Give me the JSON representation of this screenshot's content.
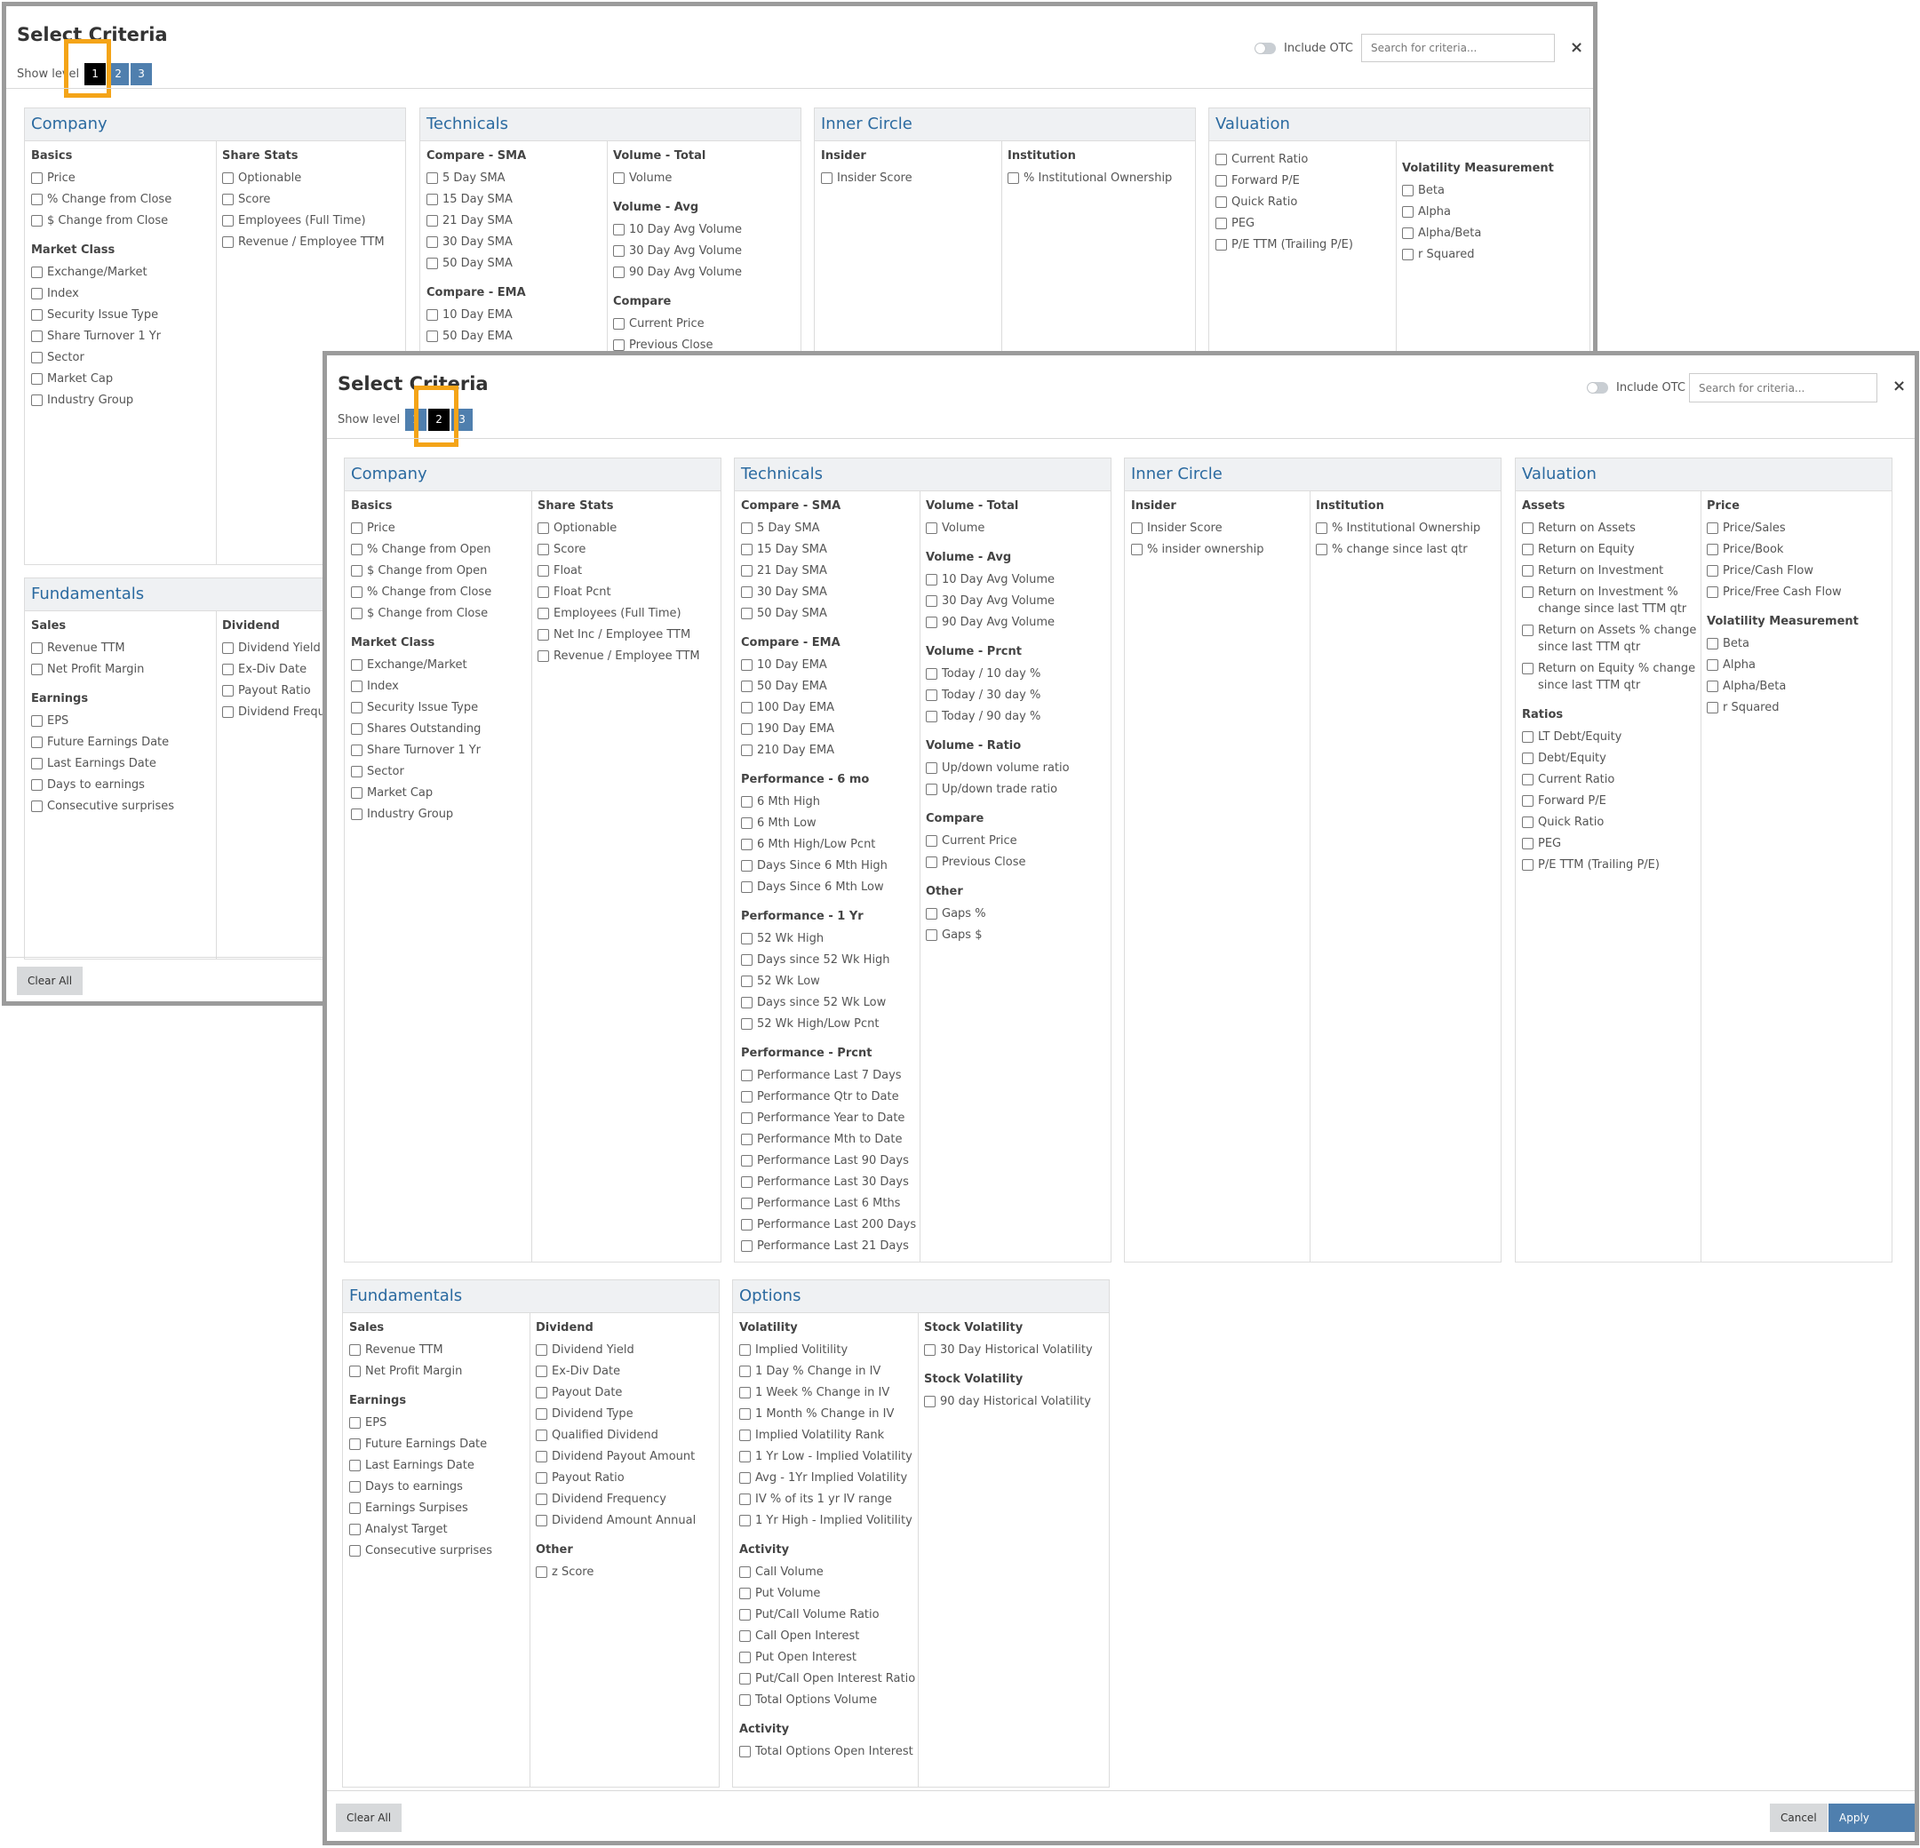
{
  "modal1": {
    "title": "Select Criteria",
    "show_level_label": "Show level",
    "levels": [
      "1",
      "2",
      "3"
    ],
    "active_level": "1",
    "include_otc_label": "Include OTC",
    "search_placeholder": "Search for criteria...",
    "close_icon": "×",
    "clear_all_label": "Clear All",
    "company": {
      "header": "Company",
      "basics_title": "Basics",
      "basics": [
        "Price",
        "% Change from Close",
        "$ Change from Close"
      ],
      "market_class_title": "Market Class",
      "market_class": [
        "Exchange/Market",
        "Index",
        "Security Issue Type",
        "Share Turnover 1 Yr",
        "Sector",
        "Market Cap",
        "Industry Group"
      ],
      "share_stats_title": "Share Stats",
      "share_stats": [
        "Optionable",
        "Score",
        "Employees (Full Time)",
        "Revenue / Employee TTM"
      ]
    },
    "technicals": {
      "header": "Technicals",
      "compare_sma_title": "Compare - SMA",
      "compare_sma": [
        "5 Day SMA",
        "15 Day SMA",
        "21 Day SMA",
        "30 Day SMA",
        "50 Day SMA"
      ],
      "compare_ema_title": "Compare - EMA",
      "compare_ema": [
        "10 Day EMA",
        "50 Day EMA"
      ],
      "volume_total_title": "Volume - Total",
      "volume_total": [
        "Volume"
      ],
      "volume_avg_title": "Volume - Avg",
      "volume_avg": [
        "10 Day Avg Volume",
        "30 Day Avg Volume",
        "90 Day Avg Volume"
      ],
      "compare_title": "Compare",
      "compare": [
        "Current Price",
        "Previous Close"
      ]
    },
    "inner_circle": {
      "header": "Inner Circle",
      "insider_title": "Insider",
      "insider": [
        "Insider Score"
      ],
      "institution_title": "Institution",
      "institution": [
        "% Institutional Ownership"
      ]
    },
    "valuation": {
      "header": "Valuation",
      "left": [
        "Current Ratio",
        "Forward P/E",
        "Quick Ratio",
        "PEG",
        "P/E TTM (Trailing P/E)"
      ],
      "volatility_title": "Volatility Measurement",
      "volatility": [
        "Beta",
        "Alpha",
        "Alpha/Beta",
        "r Squared"
      ]
    },
    "fundamentals": {
      "header": "Fundamentals",
      "sales_title": "Sales",
      "sales": [
        "Revenue TTM",
        "Net Profit Margin"
      ],
      "earnings_title": "Earnings",
      "earnings": [
        "EPS",
        "Future Earnings Date",
        "Last Earnings Date",
        "Days to earnings",
        "Consecutive surprises"
      ],
      "dividend_title": "Dividend",
      "dividend": [
        "Dividend Yield",
        "Ex-Div Date",
        "Payout Ratio",
        "Dividend Freque"
      ]
    }
  },
  "modal2": {
    "title": "Select Criteria",
    "show_level_label": "Show level",
    "levels": [
      "1",
      "2",
      "3"
    ],
    "active_level": "2",
    "include_otc_label": "Include OTC",
    "search_placeholder": "Search for criteria...",
    "close_icon": "×",
    "clear_all_label": "Clear All",
    "cancel_label": "Cancel",
    "apply_label": "Apply Criteria",
    "company": {
      "header": "Company",
      "basics_title": "Basics",
      "basics": [
        "Price",
        "% Change from Open",
        "$ Change from Open",
        "% Change from Close",
        "$ Change from Close"
      ],
      "market_class_title": "Market Class",
      "market_class": [
        "Exchange/Market",
        "Index",
        "Security Issue Type",
        "Shares Outstanding",
        "Share Turnover 1 Yr",
        "Sector",
        "Market Cap",
        "Industry Group"
      ],
      "share_stats_title": "Share Stats",
      "share_stats": [
        "Optionable",
        "Score",
        "Float",
        "Float Pcnt",
        "Employees (Full Time)",
        "Net Inc / Employee TTM",
        "Revenue / Employee TTM"
      ]
    },
    "technicals": {
      "header": "Technicals",
      "compare_sma_title": "Compare - SMA",
      "compare_sma": [
        "5 Day SMA",
        "15 Day SMA",
        "21 Day SMA",
        "30 Day SMA",
        "50 Day SMA"
      ],
      "compare_ema_title": "Compare - EMA",
      "compare_ema": [
        "10 Day EMA",
        "50 Day EMA",
        "100 Day EMA",
        "190 Day EMA",
        "210 Day EMA"
      ],
      "perf_6mo_title": "Performance - 6 mo",
      "perf_6mo": [
        "6 Mth High",
        "6 Mth Low",
        "6 Mth High/Low Pcnt",
        "Days Since 6 Mth High",
        "Days Since 6 Mth Low"
      ],
      "perf_1yr_title": "Performance - 1 Yr",
      "perf_1yr": [
        "52 Wk High",
        "Days since 52 Wk High",
        "52 Wk Low",
        "Days since 52 Wk Low",
        "52 Wk High/Low Pcnt"
      ],
      "perf_prcnt_title": "Performance - Prcnt",
      "perf_prcnt": [
        "Performance Last 7 Days",
        "Performance Qtr to Date",
        "Performance Year to Date",
        "Performance Mth to Date",
        "Performance Last 90 Days",
        "Performance Last 30 Days",
        "Performance Last 6 Mths",
        "Performance Last 200 Days",
        "Performance Last 21 Days"
      ],
      "volume_total_title": "Volume - Total",
      "volume_total": [
        "Volume"
      ],
      "volume_avg_title": "Volume - Avg",
      "volume_avg": [
        "10 Day Avg Volume",
        "30 Day Avg Volume",
        "90 Day Avg Volume"
      ],
      "volume_prcnt_title": "Volume - Prcnt",
      "volume_prcnt": [
        "Today / 10 day %",
        "Today / 30 day %",
        "Today / 90 day %"
      ],
      "volume_ratio_title": "Volume - Ratio",
      "volume_ratio": [
        "Up/down volume ratio",
        "Up/down trade ratio"
      ],
      "compare_title": "Compare",
      "compare": [
        "Current Price",
        "Previous Close"
      ],
      "other_title": "Other",
      "other": [
        "Gaps %",
        "Gaps $"
      ]
    },
    "inner_circle": {
      "header": "Inner Circle",
      "insider_title": "Insider",
      "insider": [
        "Insider Score",
        "% insider ownership"
      ],
      "institution_title": "Institution",
      "institution": [
        "% Institutional Ownership",
        "% change since last qtr"
      ]
    },
    "valuation": {
      "header": "Valuation",
      "assets_title": "Assets",
      "assets": [
        "Return on Assets",
        "Return on Equity",
        "Return on Investment",
        "Return on Investment % change since last TTM qtr",
        "Return on Assets % change since last TTM qtr",
        "Return on Equity % change since last TTM qtr"
      ],
      "ratios_title": "Ratios",
      "ratios": [
        "LT Debt/Equity",
        "Debt/Equity",
        "Current Ratio",
        "Forward P/E",
        "Quick Ratio",
        "PEG",
        "P/E TTM (Trailing P/E)"
      ],
      "price_title": "Price",
      "price": [
        "Price/Sales",
        "Price/Book",
        "Price/Cash Flow",
        "Price/Free Cash Flow"
      ],
      "volatility_title": "Volatility Measurement",
      "volatility": [
        "Beta",
        "Alpha",
        "Alpha/Beta",
        "r Squared"
      ]
    },
    "fundamentals": {
      "header": "Fundamentals",
      "sales_title": "Sales",
      "sales": [
        "Revenue TTM",
        "Net Profit Margin"
      ],
      "earnings_title": "Earnings",
      "earnings": [
        "EPS",
        "Future Earnings Date",
        "Last Earnings Date",
        "Days to earnings",
        "Earnings Surpises",
        "Analyst Target",
        "Consecutive surprises"
      ],
      "dividend_title": "Dividend",
      "dividend": [
        "Dividend Yield",
        "Ex-Div Date",
        "Payout Date",
        "Dividend Type",
        "Qualified Dividend",
        "Dividend Payout Amount",
        "Payout Ratio",
        "Dividend Frequency",
        "Dividend Amount Annual"
      ],
      "other_title": "Other",
      "other": [
        "z Score"
      ]
    },
    "options": {
      "header": "Options",
      "volatility_title": "Volatility",
      "volatility": [
        "Implied Volitility",
        "1 Day % Change in IV",
        "1 Week % Change in IV",
        "1 Month % Change in IV",
        "Implied Volatility Rank",
        "1 Yr Low - Implied Volatility",
        "Avg - 1Yr Implied Volatility",
        "IV % of its 1 yr IV range",
        "1 Yr High - Implied Volitility"
      ],
      "activity_title": "Activity",
      "activity": [
        "Call Volume",
        "Put Volume",
        "Put/Call Volume Ratio",
        "Call Open Interest",
        "Put Open Interest",
        "Put/Call Open Interest Ratio",
        "Total Options Volume"
      ],
      "activity2_title": "Activity",
      "activity2": [
        "Total Options Open Interest"
      ],
      "stock_vol1_title": "Stock Volatility",
      "stock_vol1": [
        "30 Day Historical Volatility"
      ],
      "stock_vol2_title": "Stock Volatility",
      "stock_vol2": [
        "90 day Historical Volatility"
      ]
    }
  }
}
